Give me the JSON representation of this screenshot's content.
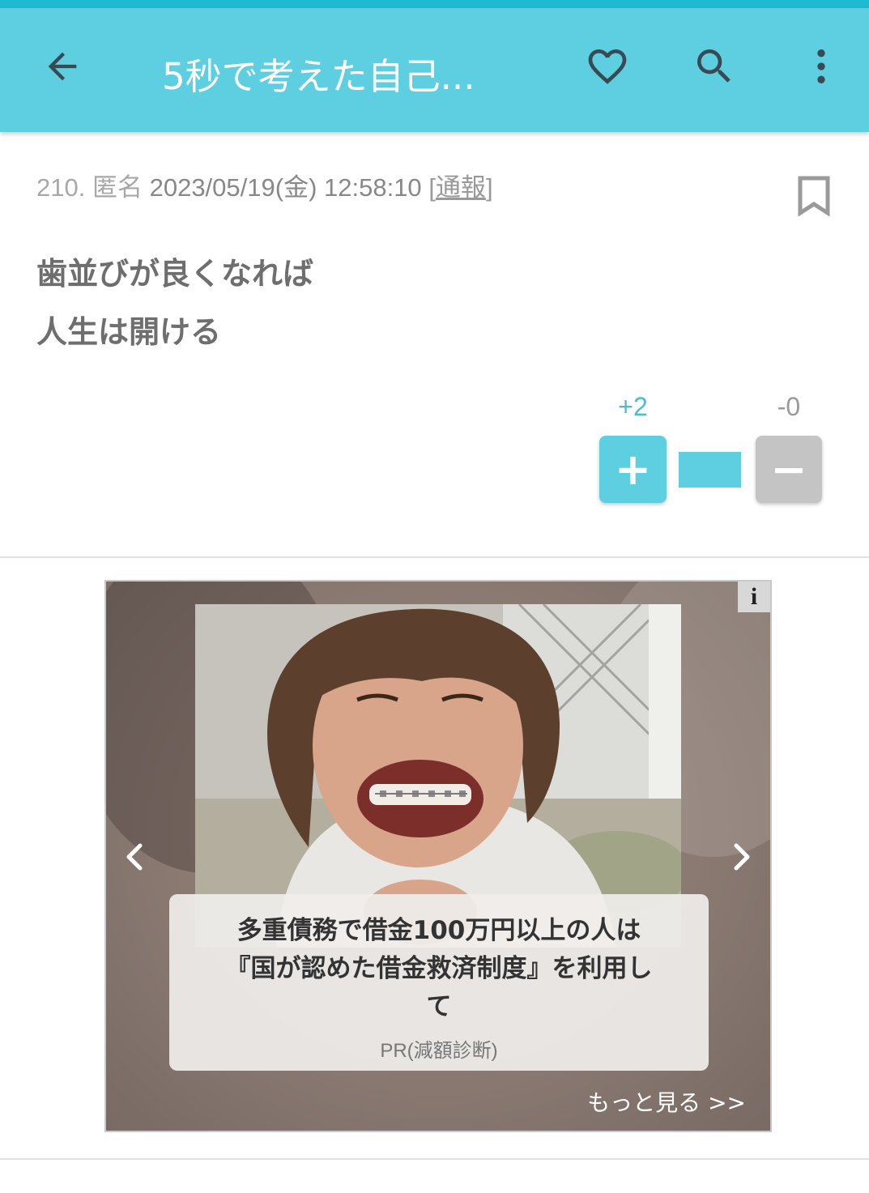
{
  "header": {
    "title": "5秒で考えた自己...",
    "icons": [
      "back-arrow-icon",
      "heart-icon",
      "search-icon",
      "more-vert-icon"
    ]
  },
  "post": {
    "number": "210.",
    "author": "匿名",
    "timestamp": "2023/05/19(金) 12:58:10",
    "report_open": "[",
    "report_label": "通報",
    "report_close": "]",
    "body_lines": [
      "歯並びが良くなれば",
      "人生は開ける"
    ]
  },
  "votes": {
    "plus_count": "+2",
    "minus_count": "-0",
    "plus_label": "+",
    "minus_label": "−",
    "plus_ratio": 1.0
  },
  "ad": {
    "info_label": "i",
    "headline_lines": [
      "多重債務で借金100万円以上の人は",
      "『国が認めた借金救済制度』を利用し",
      "て"
    ],
    "source": "PR(減額診断)",
    "more_link": "もっと見る >>"
  },
  "colors": {
    "accent": "#5ecfe0",
    "status_bar": "#1cbbd1",
    "minus_button": "#c4c4c4"
  }
}
